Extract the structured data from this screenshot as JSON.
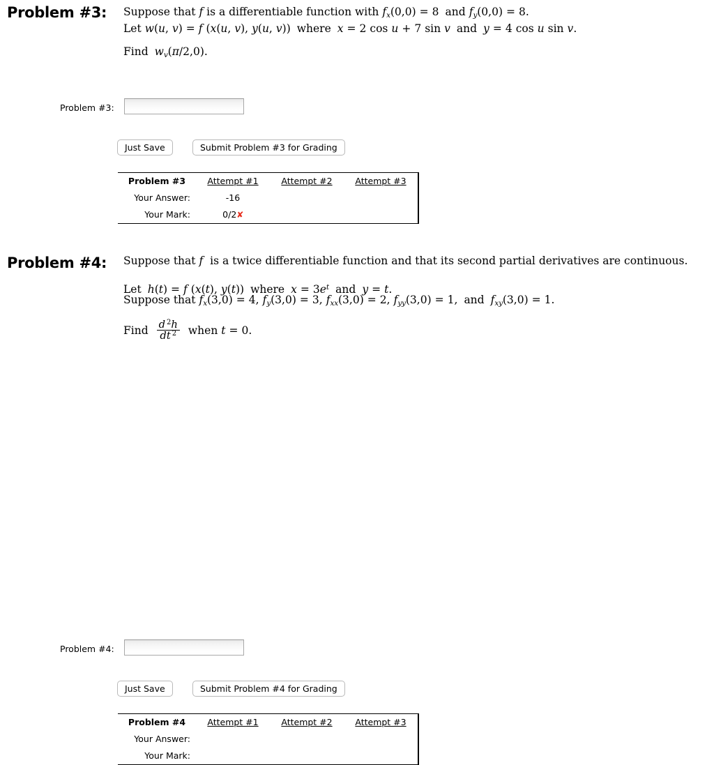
{
  "problems": [
    {
      "heading": "Problem #3:",
      "statement": {
        "line1": "Suppose that f is a differentiable function with fx(0,0) = 8 and fy(0,0) = 8.",
        "line2": "Let w(u, v) = f (x(u, v), y(u, v))  where  x = 2 cos u + 7 sin v  and  y = 4 cos u sin v.",
        "line3": "Find wv(π/2, 0)."
      },
      "answer": {
        "label": "Problem #3:",
        "value": "",
        "placeholder": ""
      },
      "buttons": {
        "save": "Just Save",
        "submit": "Submit Problem #3 for Grading"
      },
      "table": {
        "corner": "Problem #3",
        "row_labels": [
          "Your Answer:",
          "Your Mark:"
        ],
        "attempt_headers": [
          "Attempt #1",
          "Attempt #2",
          "Attempt #3"
        ],
        "answers": [
          "-16",
          "",
          ""
        ],
        "marks": [
          "0/2",
          "",
          ""
        ],
        "mark_icons": [
          "✘",
          "",
          ""
        ],
        "mark_icon_color": "#e62a19"
      }
    },
    {
      "heading": "Problem #4:",
      "statement": {
        "line1": "Suppose that f  is a twice differentiable function and that its second partial derivatives are continuous.",
        "line2": "Let h(t) = f (x(t), y(t))  where  x = 3e t  and  y = t.",
        "line3": "Suppose that fx(3,0) = 4, fy(3,0) = 3, fxx(3,0) = 2, fyy(3,0) = 1, and fxy(3,0) = 1.",
        "line4": "Find d 2h/dt 2 when t = 0."
      },
      "answer": {
        "label": "Problem #4:",
        "value": "",
        "placeholder": ""
      },
      "buttons": {
        "save": "Just Save",
        "submit": "Submit Problem #4 for Grading"
      },
      "table": {
        "corner": "Problem #4",
        "row_labels": [
          "Your Answer:",
          "Your Mark:"
        ],
        "attempt_headers": [
          "Attempt #1",
          "Attempt #2",
          "Attempt #3"
        ],
        "answers": [
          "",
          "",
          ""
        ],
        "marks": [
          "",
          "",
          ""
        ],
        "mark_icons": [
          "",
          "",
          ""
        ],
        "mark_icon_color": "#e62a19"
      }
    }
  ]
}
